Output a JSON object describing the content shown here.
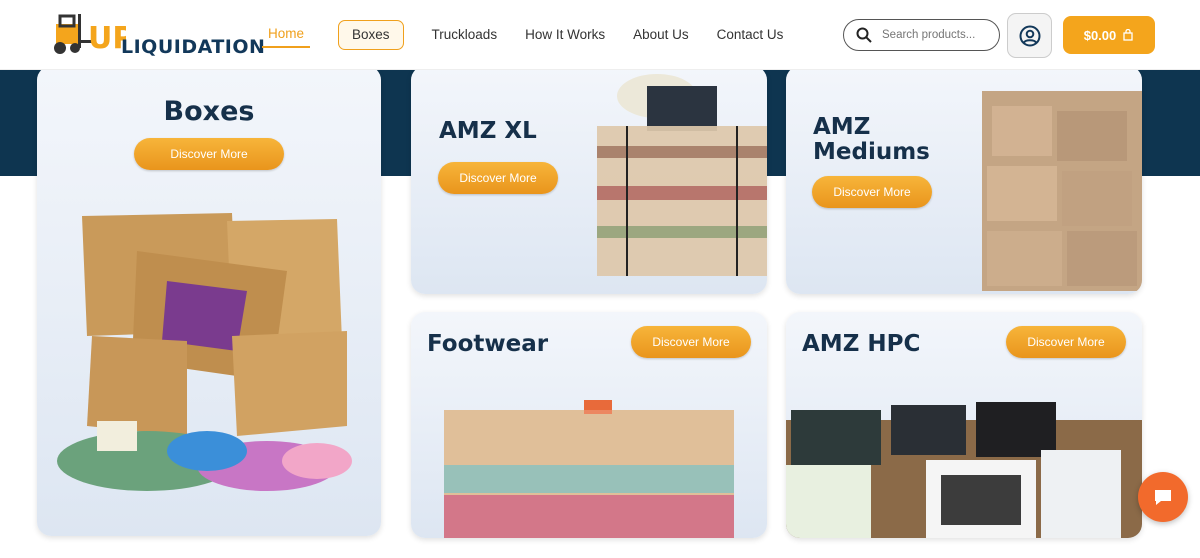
{
  "brand": {
    "logo_text": "LIQUIDATION",
    "logo_letters": "UP"
  },
  "nav": {
    "items": [
      {
        "label": "Home"
      },
      {
        "label": "Boxes"
      },
      {
        "label": "Truckloads"
      },
      {
        "label": "How It Works"
      },
      {
        "label": "About Us"
      },
      {
        "label": "Contact Us"
      }
    ]
  },
  "search": {
    "placeholder": "Search products..."
  },
  "cart": {
    "total": "$0.00"
  },
  "cards": [
    {
      "title": "Boxes",
      "button": "Discover More"
    },
    {
      "title": "AMZ XL",
      "button": "Discover More"
    },
    {
      "title_line1": "AMZ",
      "title_line2": "Mediums",
      "button": "Discover More"
    },
    {
      "title": "Footwear",
      "button": "Discover More"
    },
    {
      "title": "AMZ HPC",
      "button": "Discover More"
    }
  ],
  "colors": {
    "accent": "#f4a51c",
    "navy": "#0e3550",
    "chat": "#f26a2c"
  }
}
